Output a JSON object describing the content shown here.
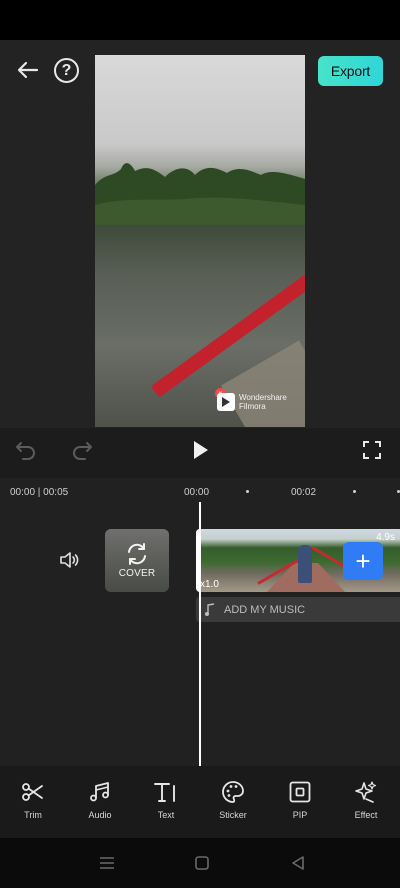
{
  "header": {
    "export_label": "Export",
    "help_symbol": "?"
  },
  "preview": {
    "watermark_line1": "Wondershare",
    "watermark_line2": "Filmora"
  },
  "timeline": {
    "current_total": "00:00 | 00:05",
    "tick_0": "00:00",
    "tick_2": "00:02",
    "cover_label": "COVER",
    "clip_duration": "4.9s",
    "clip_speed": "x1.0",
    "add_symbol": "+",
    "music_label": "ADD MY MUSIC"
  },
  "toolbar": {
    "items": [
      {
        "label": "Trim",
        "icon": "scissors-icon"
      },
      {
        "label": "Audio",
        "icon": "music-notes-icon"
      },
      {
        "label": "Text",
        "icon": "text-icon"
      },
      {
        "label": "Sticker",
        "icon": "palette-icon"
      },
      {
        "label": "PIP",
        "icon": "pip-icon"
      },
      {
        "label": "Effect",
        "icon": "sparkle-icon"
      }
    ]
  },
  "colors": {
    "accent": "#2f7cf6",
    "export_start": "#47e3c9",
    "export_end": "#2fd6d8",
    "background": "#232323"
  }
}
